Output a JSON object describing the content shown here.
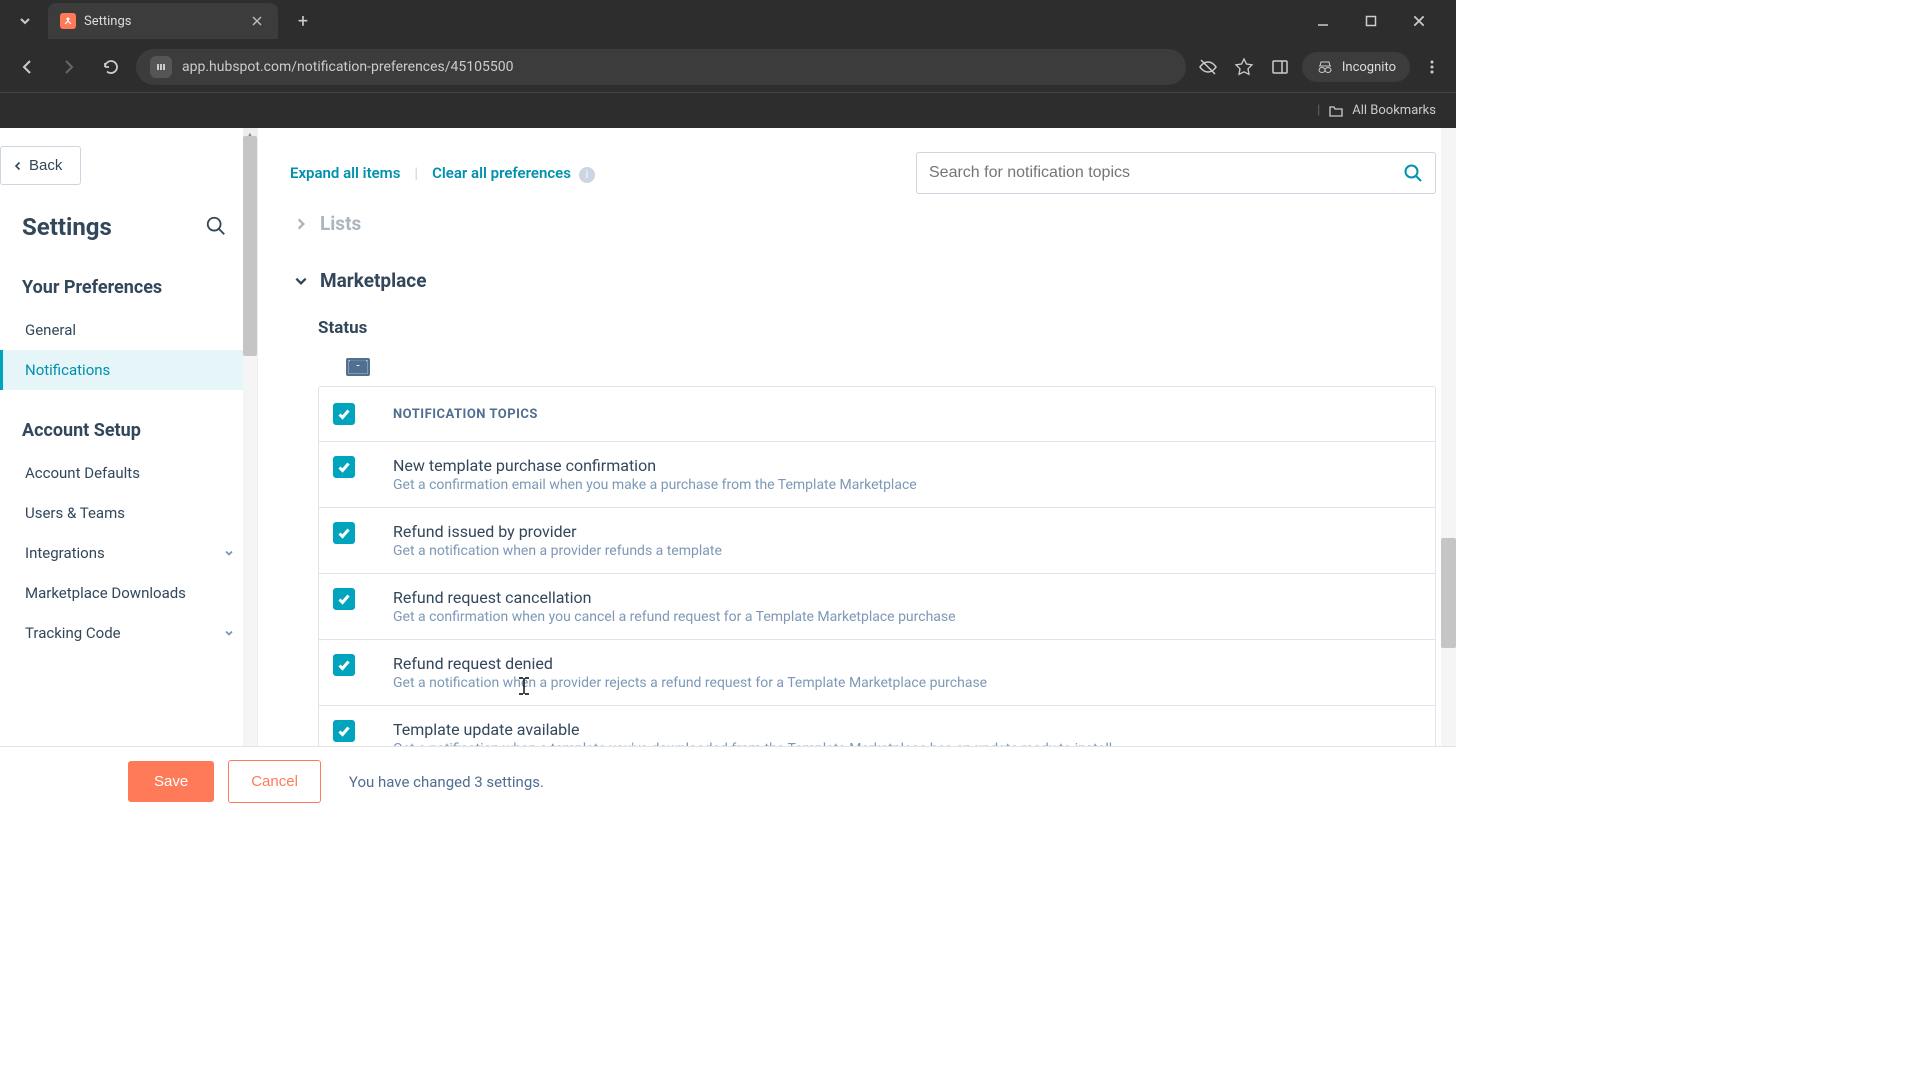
{
  "browser": {
    "tab_title": "Settings",
    "url": "app.hubspot.com/notification-preferences/45105500",
    "incognito_label": "Incognito",
    "all_bookmarks": "All Bookmarks"
  },
  "sidebar": {
    "back_label": "Back",
    "heading": "Settings",
    "preferences_label": "Your Preferences",
    "account_setup_label": "Account Setup",
    "pref_items": [
      {
        "label": "General",
        "active": false
      },
      {
        "label": "Notifications",
        "active": true
      }
    ],
    "account_items": [
      {
        "label": "Account Defaults",
        "expand": false
      },
      {
        "label": "Users & Teams",
        "expand": false
      },
      {
        "label": "Integrations",
        "expand": true
      },
      {
        "label": "Marketplace Downloads",
        "expand": false
      },
      {
        "label": "Tracking Code",
        "expand": true
      }
    ]
  },
  "main": {
    "expand_all": "Expand all items",
    "clear_all": "Clear all preferences",
    "search_placeholder": "Search for notification topics",
    "sections": {
      "lists_title": "Lists",
      "marketplace_title": "Marketplace",
      "status_label": "Status",
      "topics_header": "NOTIFICATION TOPICS"
    },
    "topics": [
      {
        "title": "New template purchase confirmation",
        "desc": "Get a confirmation email when you make a purchase from the Template Marketplace"
      },
      {
        "title": "Refund issued by provider",
        "desc": "Get a notification when a provider refunds a template"
      },
      {
        "title": "Refund request cancellation",
        "desc": "Get a confirmation when you cancel a refund request for a Template Marketplace purchase"
      },
      {
        "title": "Refund request denied",
        "desc": "Get a notification when a provider rejects a refund request for a Template Marketplace purchase"
      },
      {
        "title": "Template update available",
        "desc": "Get a notification when a template you've downloaded from the Template Marketplace has an update ready to install"
      }
    ]
  },
  "savebar": {
    "save": "Save",
    "cancel": "Cancel",
    "message": "You have changed 3 settings."
  },
  "colors": {
    "accent_teal": "#00a4bd",
    "accent_orange": "#ff7a59",
    "text_dark": "#33475b",
    "text_muted": "#7c98b6"
  }
}
